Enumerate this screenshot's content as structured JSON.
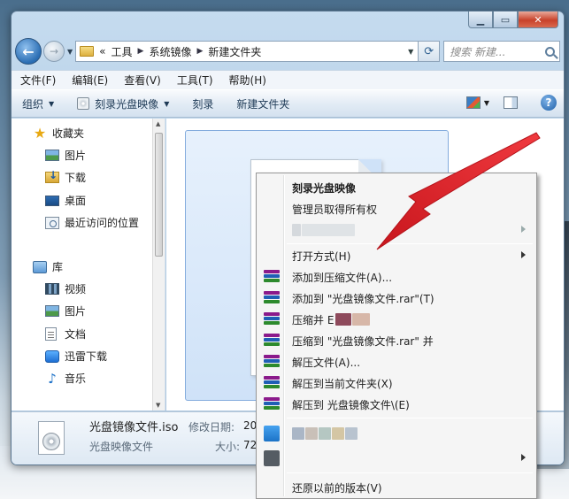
{
  "address": {
    "overflow": "«",
    "segments": [
      "工具",
      "系统镜像",
      "新建文件夹"
    ]
  },
  "search": {
    "placeholder": "搜索 新建..."
  },
  "menubar": [
    "文件(F)",
    "编辑(E)",
    "查看(V)",
    "工具(T)",
    "帮助(H)"
  ],
  "toolbar": {
    "organize": "组织",
    "burn_image": "刻录光盘映像",
    "burn": "刻录",
    "new_folder": "新建文件夹"
  },
  "nav": {
    "favorites": "收藏夹",
    "pictures": "图片",
    "downloads": "下载",
    "desktop": "桌面",
    "recent": "最近访问的位置",
    "libraries": "库",
    "videos": "视频",
    "lib_pictures": "图片",
    "documents": "文档",
    "xunlei": "迅雷下载",
    "music": "音乐"
  },
  "details": {
    "file_name": "光盘镜像文件.iso",
    "modified_label": "修改日期:",
    "modified_value": "20",
    "type": "光盘映像文件",
    "size_label": "大小:",
    "size_value": "72"
  },
  "context_menu": {
    "burn_image": "刻录光盘映像",
    "take_ownership": "管理员取得所有权",
    "open_with": "打开方式(H)",
    "add_to_archive": "添加到压缩文件(A)...",
    "add_to_rar": "添加到 \"光盘镜像文件.rar\"(T)",
    "compress_and": "压缩并 E",
    "compress_to_rar": "压缩到 \"光盘镜像文件.rar\" 并",
    "extract_files": "解压文件(A)...",
    "extract_here": "解压到当前文件夹(X)",
    "extract_to_folder": "解压到 光盘镜像文件\\(E)",
    "restore_previous": "还原以前的版本(V)"
  },
  "colors": {
    "annotation_arrow": "#e8232a",
    "selection": "#cfe2f8",
    "menu_bg": "#f5f5f5"
  }
}
